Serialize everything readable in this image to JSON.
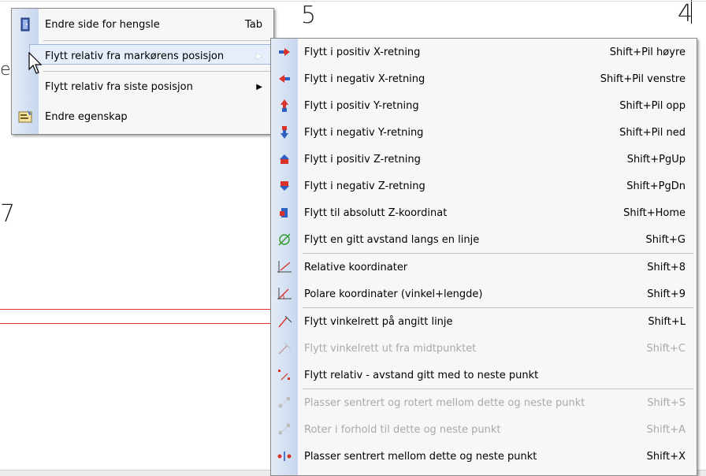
{
  "canvas": {
    "labels": [
      "5",
      "4",
      "7",
      "e"
    ],
    "line_color": "#e0342f"
  },
  "main_menu": {
    "items": [
      {
        "label": "Endre side for hengsle",
        "shortcut": "Tab",
        "icon": "door-hinge-icon"
      },
      {
        "label": "Flytt relativ fra markørens posisjon",
        "submenu": true,
        "icon": "",
        "highlighted": true
      },
      {
        "label": "Flytt relativ fra siste posisjon",
        "submenu": true,
        "icon": ""
      },
      {
        "label": "Endre egenskap",
        "icon": "properties-icon"
      }
    ]
  },
  "sub_menu": {
    "groups": [
      [
        {
          "label": "Flytt i positiv X-retning",
          "shortcut": "Shift+Pil høyre",
          "icon": "move-x-positive-icon",
          "disabled": false
        },
        {
          "label": "Flytt i negativ X-retning",
          "shortcut": "Shift+Pil venstre",
          "icon": "move-x-negative-icon",
          "disabled": false
        },
        {
          "label": "Flytt i positiv Y-retning",
          "shortcut": "Shift+Pil opp",
          "icon": "move-y-positive-icon",
          "disabled": false
        },
        {
          "label": "Flytt i negativ Y-retning",
          "shortcut": "Shift+Pil ned",
          "icon": "move-y-negative-icon",
          "disabled": false
        },
        {
          "label": "Flytt i positiv Z-retning",
          "shortcut": "Shift+PgUp",
          "icon": "move-z-positive-icon",
          "disabled": false
        },
        {
          "label": "Flytt i negativ Z-retning",
          "shortcut": "Shift+PgDn",
          "icon": "move-z-negative-icon",
          "disabled": false
        },
        {
          "label": "Flytt til absolutt Z-koordinat",
          "shortcut": "Shift+Home",
          "icon": "absolute-z-icon",
          "disabled": false
        },
        {
          "label": "Flytt en gitt avstand langs en linje",
          "shortcut": "Shift+G",
          "icon": "diameter-line-icon",
          "disabled": false
        }
      ],
      [
        {
          "label": "Relative koordinater",
          "shortcut": "Shift+8",
          "icon": "relative-coordinates-icon",
          "disabled": false
        },
        {
          "label": "Polare koordinater (vinkel+lengde)",
          "shortcut": "Shift+9",
          "icon": "polar-coordinates-icon",
          "disabled": false
        }
      ],
      [
        {
          "label": "Flytt vinkelrett på angitt linje",
          "shortcut": "Shift+L",
          "icon": "perpendicular-line-icon",
          "disabled": false
        },
        {
          "label": "Flytt vinkelrett ut fra midtpunktet",
          "shortcut": "Shift+C",
          "icon": "perpendicular-midpoint-icon",
          "disabled": true
        },
        {
          "label": "Flytt relativ - avstand gitt med to neste punkt",
          "shortcut": "",
          "icon": "two-points-distance-icon",
          "disabled": false
        }
      ],
      [
        {
          "label": "Plasser sentrert og rotert mellom dette og neste punkt",
          "shortcut": "Shift+S",
          "icon": "center-rotate-icon",
          "disabled": true
        },
        {
          "label": "Roter i forhold til dette og neste punkt",
          "shortcut": "Shift+A",
          "icon": "rotate-points-icon",
          "disabled": true
        },
        {
          "label": "Plasser sentrert mellom dette og neste punkt",
          "shortcut": "Shift+X",
          "icon": "center-between-icon",
          "disabled": false
        }
      ]
    ]
  },
  "colors": {
    "highlight_bg": "#e6eefb",
    "highlight_border": "#9bb3de",
    "gutter": "#c7d7ef",
    "disabled_text": "#a9a9a9"
  }
}
